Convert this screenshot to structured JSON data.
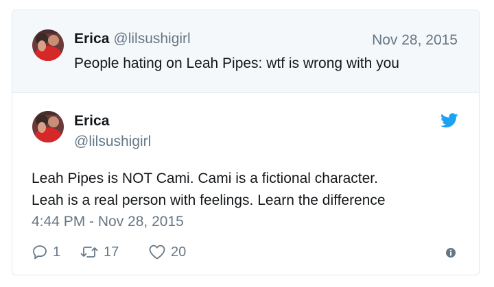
{
  "reply_context": {
    "name": "Erica",
    "handle": "@lilsushigirl",
    "date": "Nov 28, 2015",
    "text": "People hating on Leah Pipes: wtf is wrong with you"
  },
  "tweet": {
    "name": "Erica",
    "handle": "@lilsushigirl",
    "text_line1": "Leah Pipes is NOT Cami. Cami is a fictional character.",
    "text_line2": "Leah is a real person with feelings. Learn the difference",
    "timestamp": "4:44 PM - Nov 28, 2015"
  },
  "actions": {
    "reply_count": "1",
    "retweet_count": "17",
    "like_count": "20"
  },
  "icons": {
    "brand": "twitter-bird-icon",
    "reply": "reply-icon",
    "retweet": "retweet-icon",
    "like": "heart-icon",
    "info": "info-icon"
  },
  "colors": {
    "twitter_blue": "#1da1f2",
    "text_primary": "#14171a",
    "text_secondary": "#657786",
    "context_background": "#f5f8fa",
    "border": "#e1e8ed"
  }
}
